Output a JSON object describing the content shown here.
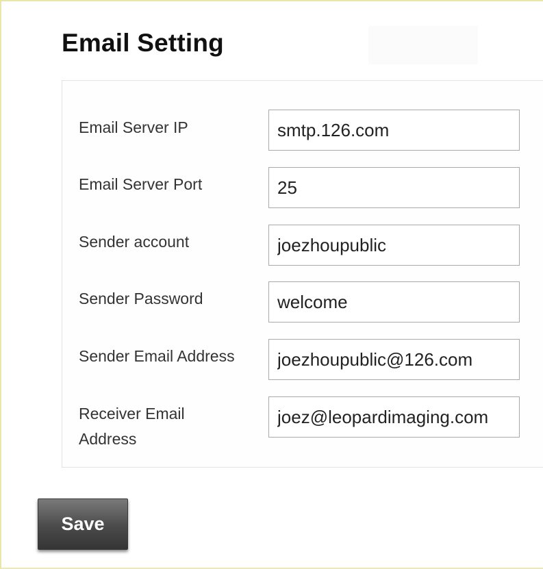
{
  "page": {
    "title": "Email Setting"
  },
  "form": {
    "fields": [
      {
        "label": "Email Server IP",
        "value": "smtp.126.com"
      },
      {
        "label": "Email Server Port",
        "value": "25"
      },
      {
        "label": "Sender account",
        "value": "joezhoupublic"
      },
      {
        "label": "Sender Password",
        "value": "welcome"
      },
      {
        "label": "Sender Email Address",
        "value": "joezhoupublic@126.com"
      },
      {
        "label": "Receiver Email Address",
        "value": "joez@leopardimaging.com"
      }
    ]
  },
  "actions": {
    "save_label": "Save"
  },
  "colors": {
    "button_dark": "#4a4a4a",
    "frame_border": "#e9e6a8",
    "input_border": "#a9a9a9"
  }
}
